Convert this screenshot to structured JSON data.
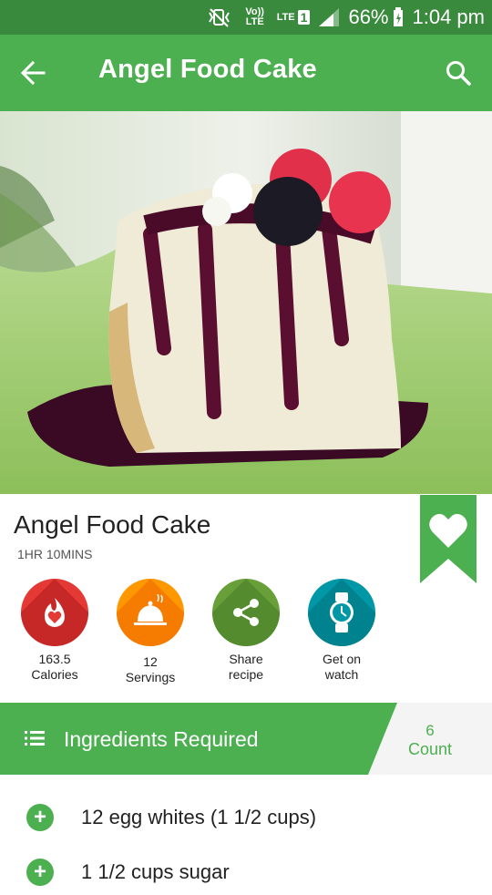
{
  "status_bar": {
    "volte_label": "Vo)) LTE",
    "lte_label": "LTE",
    "sim_label": "1",
    "battery": "66%",
    "time": "1:04 pm"
  },
  "app_bar": {
    "title": "Angel Food Cake",
    "back_icon": "arrow-back-icon",
    "search_icon": "search-icon",
    "color": "#4caf50"
  },
  "recipe": {
    "title": "Angel Food Cake",
    "duration": "1HR 10MINS",
    "bookmark_icon": "heart-bookmark-icon"
  },
  "stats": [
    {
      "value": "163.5",
      "label": "Calories",
      "icon": "calorie-flame-icon",
      "color": "#e53935"
    },
    {
      "value": "12",
      "label": "Servings",
      "icon": "serving-dish-icon",
      "color": "#ff9800"
    },
    {
      "value": "Share",
      "label": "recipe",
      "icon": "share-icon",
      "color": "#689f38"
    },
    {
      "value": "Get on",
      "label": "watch",
      "icon": "watch-icon",
      "color": "#0097a7"
    }
  ],
  "ingredients": {
    "header": "Ingredients Required",
    "count": "6",
    "count_label": "Count",
    "items": [
      {
        "text": "12 egg whites (1 1/2 cups)"
      },
      {
        "text": "1 1/2 cups sugar"
      }
    ]
  }
}
